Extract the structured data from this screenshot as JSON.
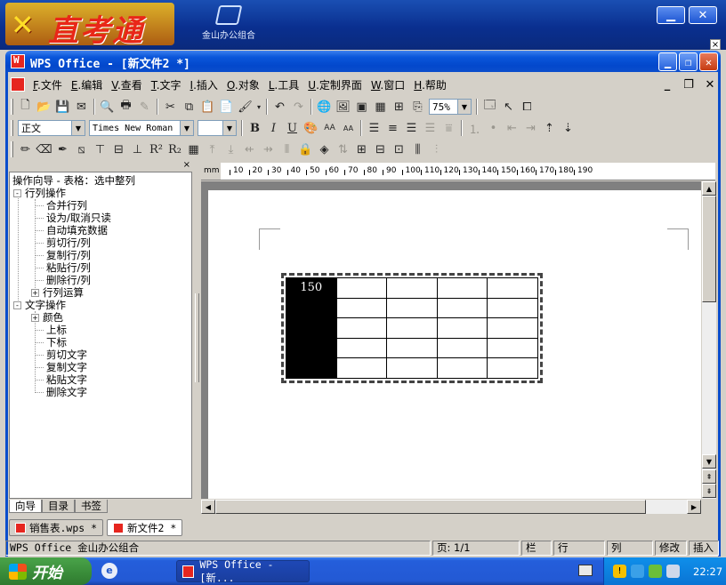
{
  "banner": {
    "logo_mark": "✕",
    "logo_text": "直考通",
    "kso_label": "金山办公组合",
    "minimize": "▁",
    "close": "✕",
    "small_close": "×"
  },
  "window": {
    "title": "WPS Office - [新文件2 *]",
    "min": "▁",
    "max": "❐",
    "close": "✕"
  },
  "menu": [
    {
      "key": "F",
      "label": "文件"
    },
    {
      "key": "E",
      "label": "编辑"
    },
    {
      "key": "V",
      "label": "查看"
    },
    {
      "key": "T",
      "label": "文字"
    },
    {
      "key": "I",
      "label": "插入"
    },
    {
      "key": "O",
      "label": "对象"
    },
    {
      "key": "L",
      "label": "工具"
    },
    {
      "key": "U",
      "label": "定制界面"
    },
    {
      "key": "W",
      "label": "窗口"
    },
    {
      "key": "H",
      "label": "帮助"
    }
  ],
  "doc_controls": {
    "min": "_",
    "restore": "❐",
    "close": "✕"
  },
  "toolbar": {
    "zoom": "75%",
    "style": "正文",
    "font": "Times New Roman",
    "size": "",
    "bold": "B",
    "italic": "I",
    "underline": "U",
    "font_large": "AA",
    "font_small": "AA",
    "superscript": "R²",
    "subscript": "R₂"
  },
  "panel": {
    "close": "×",
    "header": "操作向导 - 表格：选中整列",
    "groups": [
      {
        "label": "行列操作",
        "expander": "-",
        "items": [
          "合并行列",
          "设为/取消只读",
          "自动填充数据",
          "剪切行/列",
          "复制行/列",
          "粘贴行/列",
          "删除行/列"
        ],
        "sub": {
          "expander": "+",
          "label": "行列运算"
        }
      },
      {
        "label": "文字操作",
        "expander": "-",
        "sub": {
          "expander": "+",
          "label": "颜色"
        },
        "items": [
          "上标",
          "下标",
          "剪切文字",
          "复制文字",
          "粘贴文字",
          "删除文字"
        ]
      }
    ],
    "tabs": [
      "向导",
      "目录",
      "书签"
    ]
  },
  "ruler": {
    "unit": "mm",
    "labels": [
      "10",
      "20",
      "30",
      "40",
      "50",
      "60",
      "70",
      "80",
      "90",
      "100",
      "110",
      "120",
      "130",
      "140",
      "150",
      "160",
      "170",
      "180",
      "190"
    ]
  },
  "table": {
    "rows": [
      [
        "150",
        "",
        "",
        "",
        ""
      ],
      [
        "",
        "",
        "",
        "",
        ""
      ],
      [
        "",
        "",
        "",
        "",
        ""
      ],
      [
        "",
        "",
        "",
        "",
        ""
      ],
      [
        "",
        "",
        "",
        "",
        ""
      ]
    ],
    "selected_column": 0
  },
  "scroll": {
    "up": "▲",
    "down": "▼",
    "left": "◀",
    "right": "▶",
    "page_up": "⇞",
    "page_down": "⇟"
  },
  "doc_tabs": [
    {
      "label": "销售表.wps *",
      "active": false
    },
    {
      "label": "新文件2 *",
      "active": true
    }
  ],
  "status": {
    "app": "WPS Office 金山办公组合",
    "page": "页: 1/1",
    "column_label": "栏",
    "row_label": "行",
    "col_label": "列",
    "modify": "修改",
    "insert": "插入"
  },
  "taskbar": {
    "start": "开始",
    "quicklaunch": "e",
    "task_label": "WPS Office - [新...",
    "tray_shield": "!",
    "clock": "22:27"
  }
}
